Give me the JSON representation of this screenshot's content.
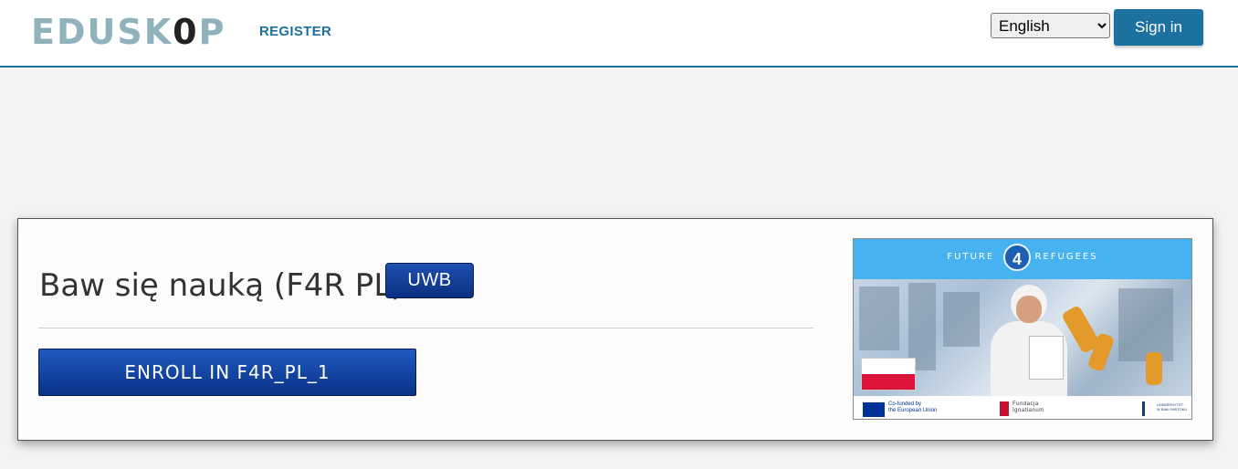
{
  "header": {
    "logo_text_a": "EDUSK",
    "logo_text_zero": "0",
    "logo_text_b": "P",
    "register_label": "REGISTER",
    "language": {
      "selected": "English",
      "options": [
        "English"
      ]
    },
    "signin_label": "Sign in"
  },
  "course": {
    "title": "Baw się nauką (F4R PL)",
    "badge": "UWB",
    "enroll_label": "ENROLL IN F4R_PL_1"
  },
  "banner": {
    "top_text_a": "FUTURE",
    "top_text_num": "4",
    "top_text_b": "REFUGEES",
    "eu_text_1": "Co-funded by",
    "eu_text_2": "the European Union",
    "foundation_text_1": "Fundacja",
    "foundation_text_2": "Ignatianum",
    "university_text_1": "UNIWERSYTET",
    "university_text_2": "W BIAŁYMSTOKU"
  },
  "colors": {
    "accent": "#1d71a0",
    "button_blue": "#0a3287",
    "banner_blue": "#47b2f0"
  }
}
